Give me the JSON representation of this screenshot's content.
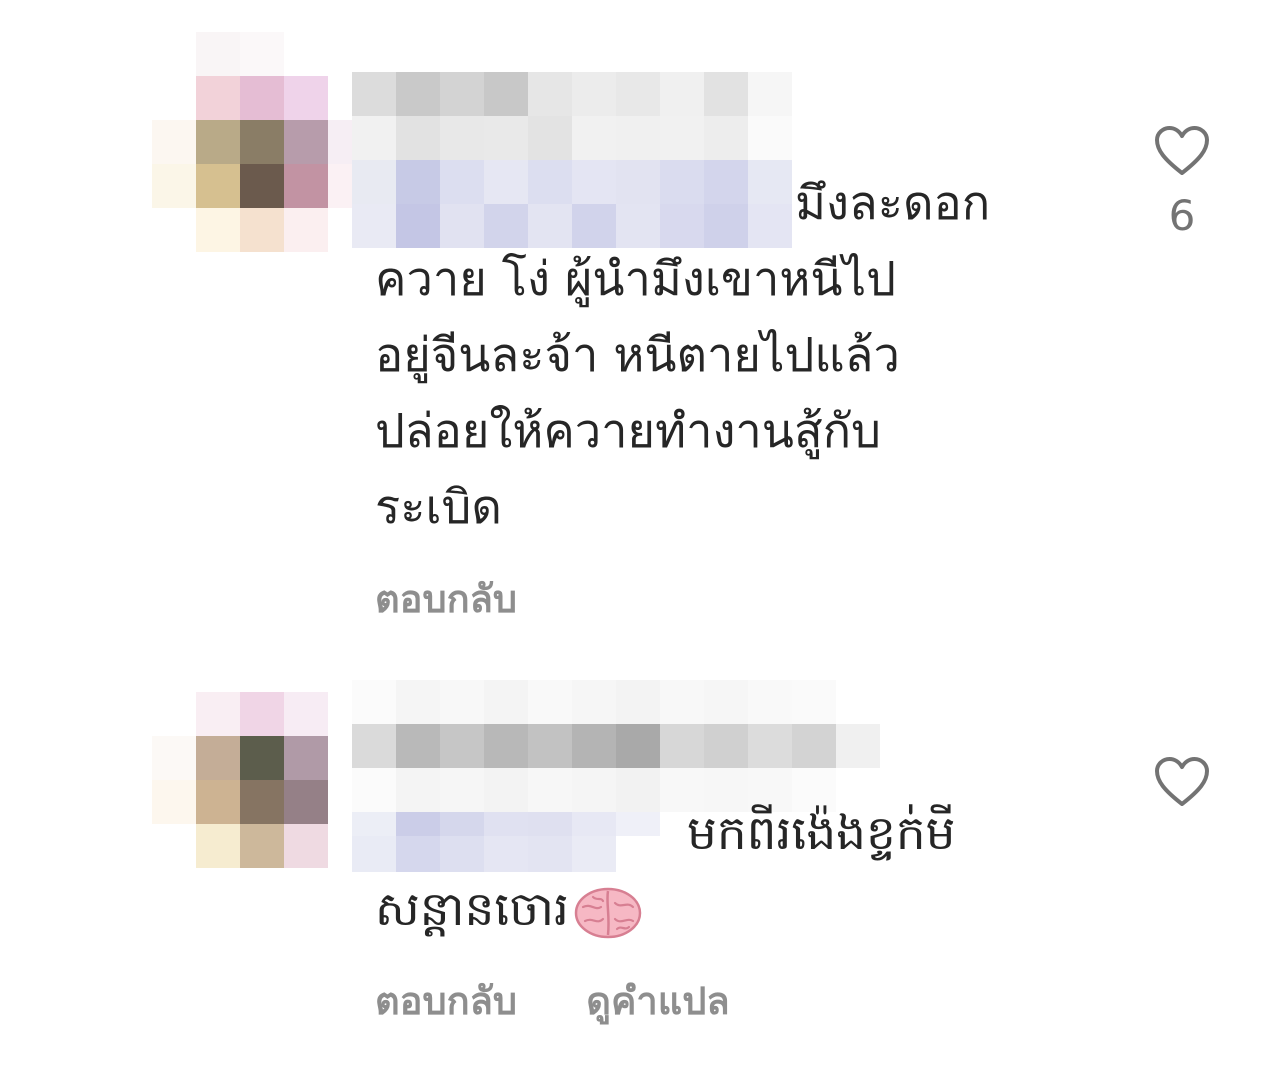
{
  "comments": [
    {
      "text_first_line": "มึงละดอก",
      "text_lines": [
        "ควาย โง่ ผู้นำมึงเขาหนีไป",
        "อยู่จีนละจ้า หนีตายไปแล้ว",
        "ปล่อยให้ควายทำงานสู้กับ",
        "ระเบิด"
      ],
      "reply_label": "ตอบกลับ",
      "like_count": "6",
      "like_icon": "heart-outline-icon"
    },
    {
      "text_first_line": "មកពីរង៉េងខ្ទក់មី",
      "text_lines": [
        "សន្តានចោរ"
      ],
      "emoji": "brain-emoji",
      "reply_label": "ตอบกลับ",
      "translate_label": "ดูคำแปล",
      "like_icon": "heart-outline-icon"
    }
  ]
}
